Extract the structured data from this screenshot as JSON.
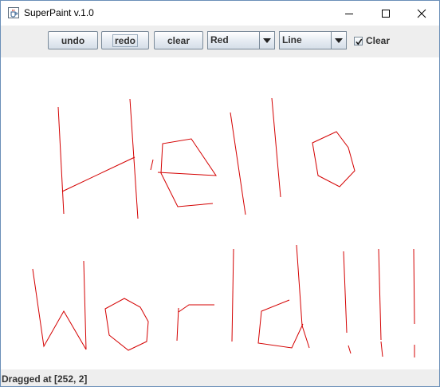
{
  "window": {
    "title": "SuperPaint v.1.0",
    "icon": "java-cup-icon"
  },
  "toolbar": {
    "undo_label": "undo",
    "redo_label": "redo",
    "clear_label": "clear",
    "color_select": {
      "selected": "Red"
    },
    "shape_select": {
      "selected": "Line"
    },
    "clear_checkbox": {
      "label": "Clear",
      "checked": true
    }
  },
  "canvas": {
    "stroke_color": "#d40000",
    "drawn_text": "Hello World!!!"
  },
  "status": {
    "text": "Dragged at [252, 2]"
  },
  "colors": {
    "toolbar_bg": "#eeeeee",
    "stroke": "#d40000"
  }
}
